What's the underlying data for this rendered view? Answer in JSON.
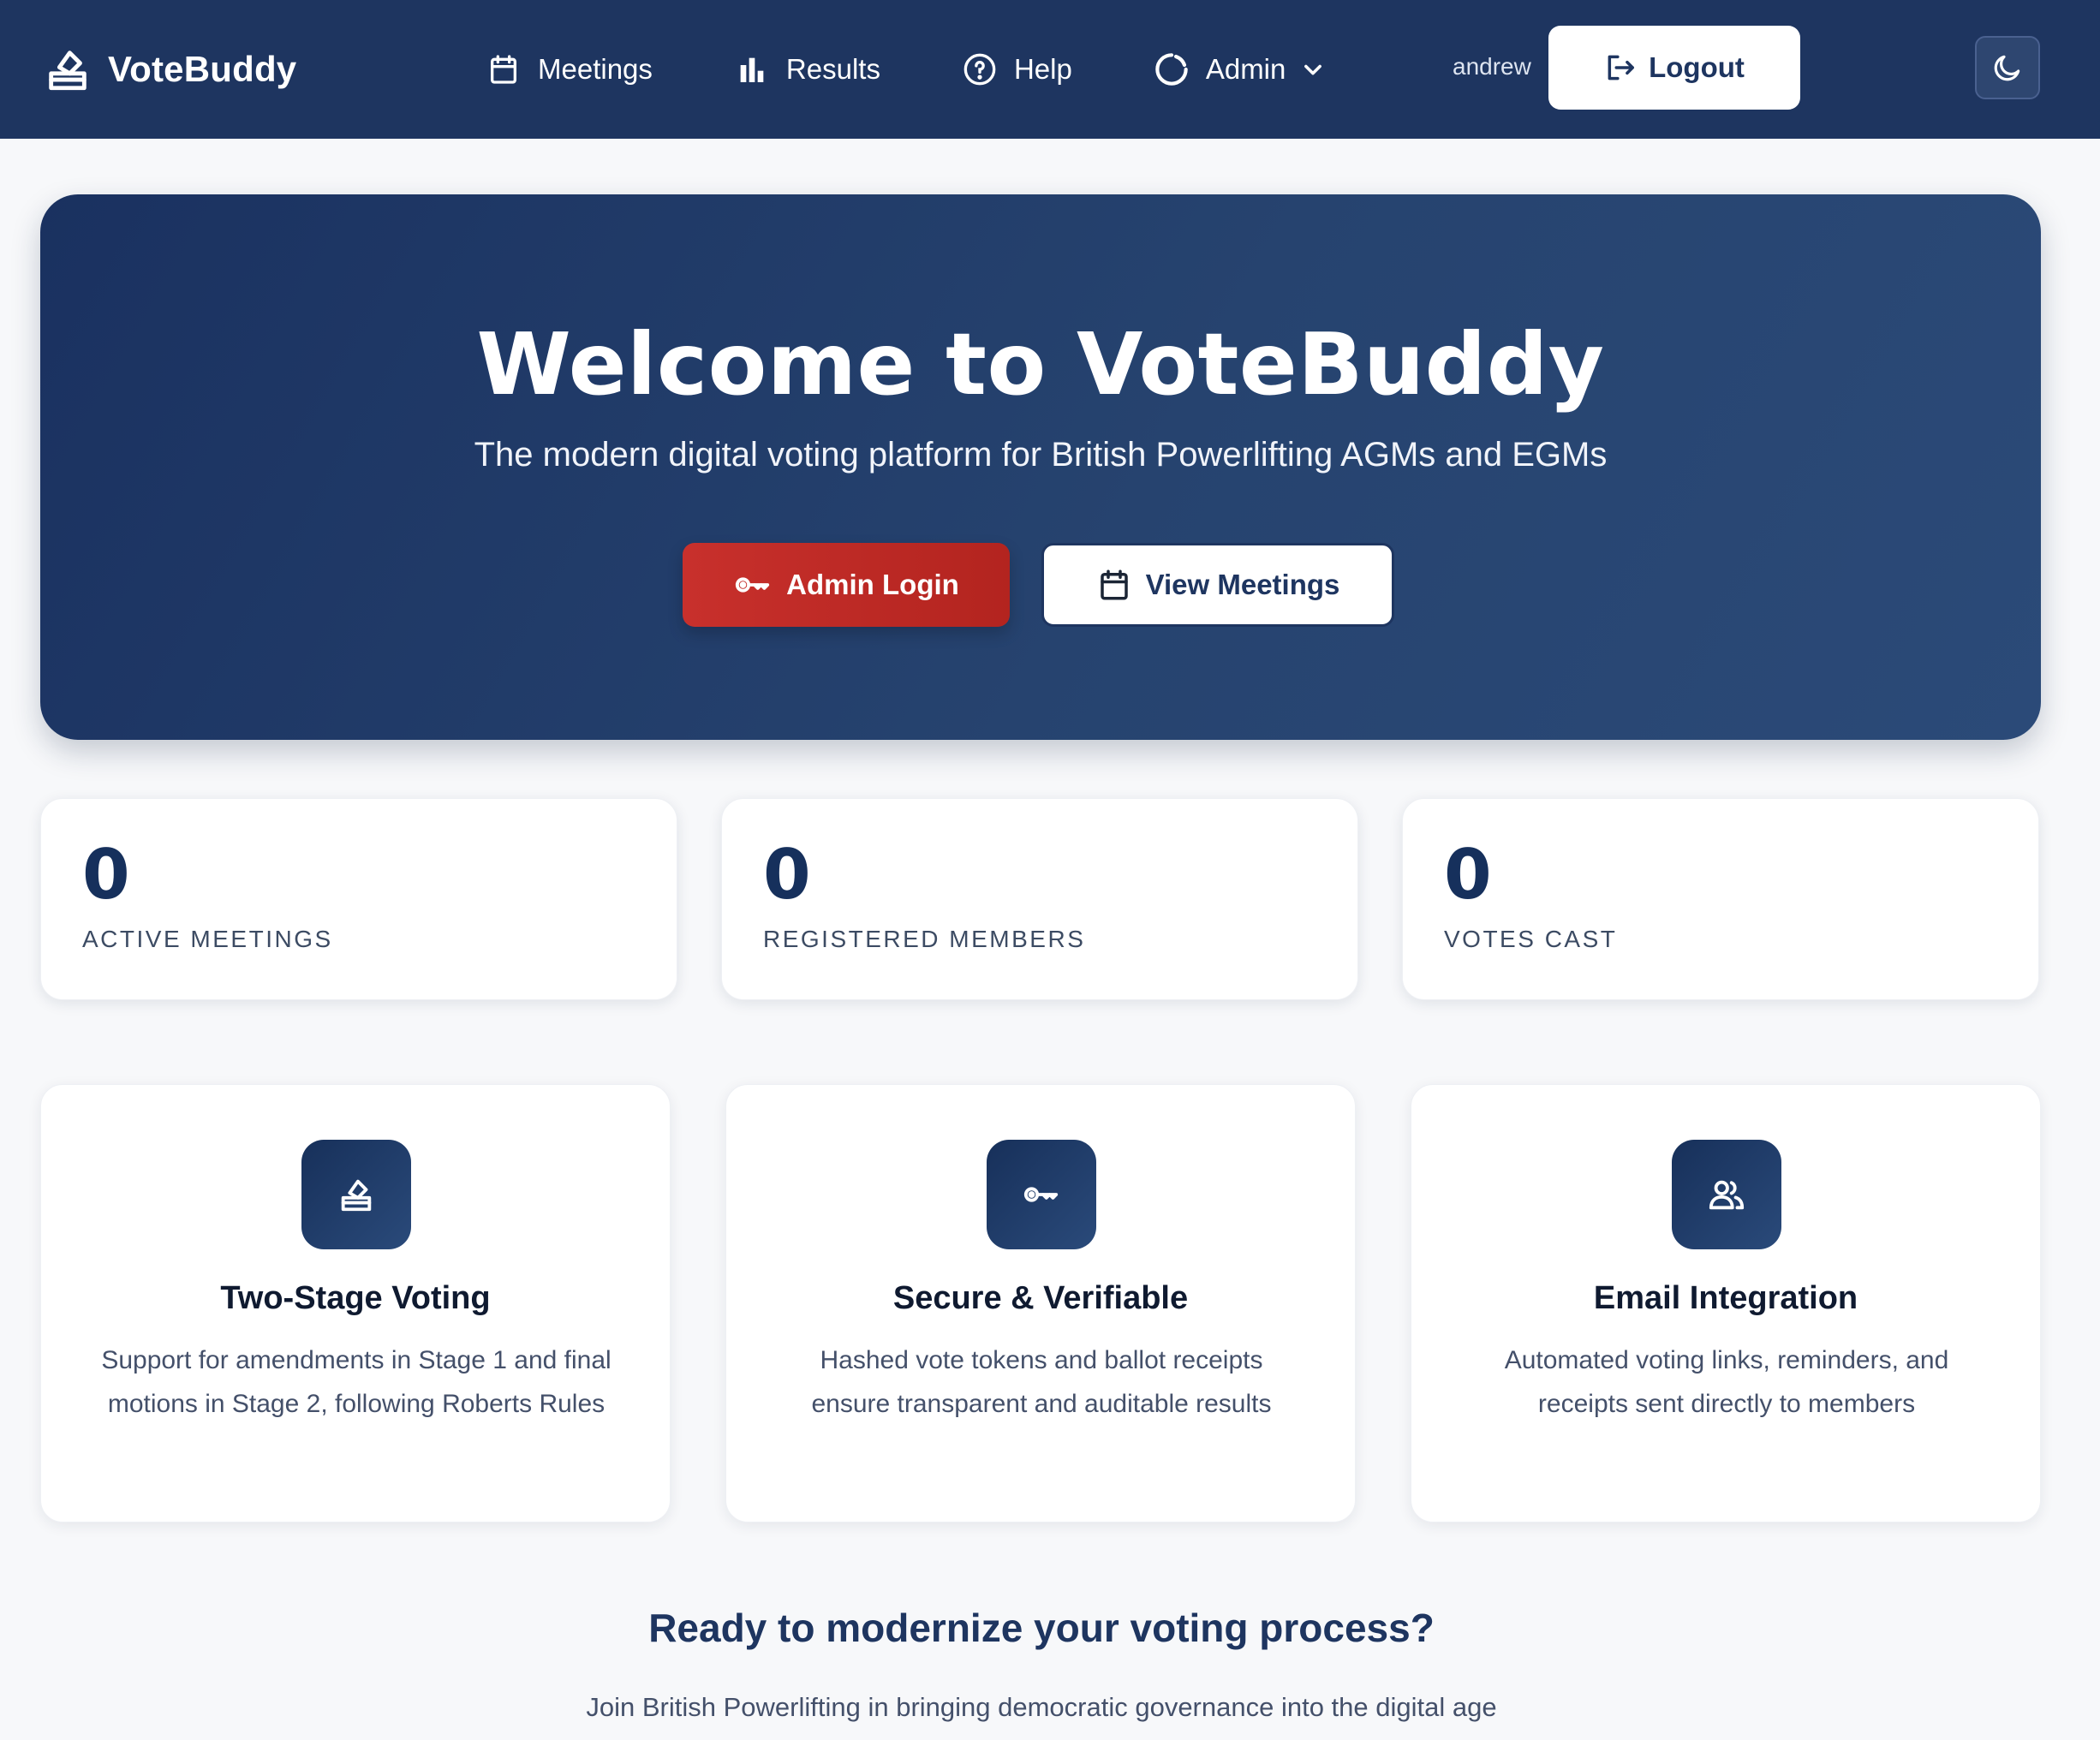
{
  "app": {
    "name": "VoteBuddy",
    "icon": "ballot-box-icon"
  },
  "nav": {
    "items": [
      {
        "label": "Meetings",
        "icon": "calendar-icon"
      },
      {
        "label": "Results",
        "icon": "bar-chart-icon"
      },
      {
        "label": "Help",
        "icon": "question-circle-icon"
      },
      {
        "label": "Admin",
        "icon": "spinner-icon",
        "dropdown": true
      }
    ],
    "username": "andrew",
    "logout_label": "Logout",
    "theme_toggle_icon": "moon-icon"
  },
  "hero": {
    "title": "Welcome to VoteBuddy",
    "subtitle": "The modern digital voting platform for British Powerlifting AGMs and EGMs",
    "primary_button": "Admin Login",
    "secondary_button": "View Meetings"
  },
  "stats": [
    {
      "value": "0",
      "label": "ACTIVE MEETINGS"
    },
    {
      "value": "0",
      "label": "REGISTERED MEMBERS"
    },
    {
      "value": "0",
      "label": "VOTES CAST"
    }
  ],
  "features": [
    {
      "icon": "ballot-box-icon",
      "title": "Two-Stage Voting",
      "description": "Support for amendments in Stage 1 and final motions in Stage 2, following Roberts Rules"
    },
    {
      "icon": "key-icon",
      "title": "Secure & Verifiable",
      "description": "Hashed vote tokens and ballot receipts ensure transparent and auditable results"
    },
    {
      "icon": "users-icon",
      "title": "Email Integration",
      "description": "Automated voting links, reminders, and receipts sent directly to members"
    }
  ],
  "cta": {
    "title": "Ready to modernize your voting process?",
    "subtitle": "Join British Powerlifting in bringing democratic governance into the digital age"
  },
  "colors": {
    "navbar": "#1e3560",
    "hero_start": "#1a3160",
    "hero_end": "#2b4a78",
    "accent_red": "#c8302c",
    "stat_number": "#16305c"
  }
}
